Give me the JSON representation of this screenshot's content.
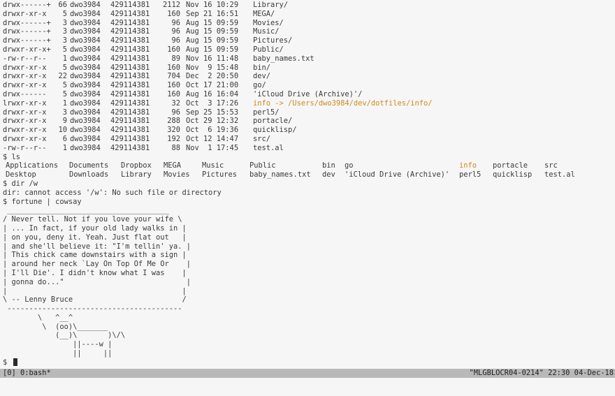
{
  "ls_long": [
    {
      "perm": "drwx------+",
      "links": "66",
      "owner": "dwo3984",
      "group": "429114381",
      "size": "2112",
      "date": "Nov 16 10:29",
      "name": "Library/",
      "link": false
    },
    {
      "perm": "drwxr-xr-x",
      "links": "5",
      "owner": "dwo3984",
      "group": "429114381",
      "size": "160",
      "date": "Sep 21 16:51",
      "name": "MEGA/",
      "link": false
    },
    {
      "perm": "drwx------+",
      "links": "3",
      "owner": "dwo3984",
      "group": "429114381",
      "size": "96",
      "date": "Aug 15 09:59",
      "name": "Movies/",
      "link": false
    },
    {
      "perm": "drwx------+",
      "links": "3",
      "owner": "dwo3984",
      "group": "429114381",
      "size": "96",
      "date": "Aug 15 09:59",
      "name": "Music/",
      "link": false
    },
    {
      "perm": "drwx------+",
      "links": "3",
      "owner": "dwo3984",
      "group": "429114381",
      "size": "96",
      "date": "Aug 15 09:59",
      "name": "Pictures/",
      "link": false
    },
    {
      "perm": "drwxr-xr-x+",
      "links": "5",
      "owner": "dwo3984",
      "group": "429114381",
      "size": "160",
      "date": "Aug 15 09:59",
      "name": "Public/",
      "link": false
    },
    {
      "perm": "-rw-r--r--",
      "links": "1",
      "owner": "dwo3984",
      "group": "429114381",
      "size": "89",
      "date": "Nov 16 11:48",
      "name": "baby_names.txt",
      "link": false
    },
    {
      "perm": "drwxr-xr-x",
      "links": "5",
      "owner": "dwo3984",
      "group": "429114381",
      "size": "160",
      "date": "Nov  9 15:48",
      "name": "bin/",
      "link": false
    },
    {
      "perm": "drwxr-xr-x",
      "links": "22",
      "owner": "dwo3984",
      "group": "429114381",
      "size": "704",
      "date": "Dec  2 20:50",
      "name": "dev/",
      "link": false
    },
    {
      "perm": "drwxr-xr-x",
      "links": "5",
      "owner": "dwo3984",
      "group": "429114381",
      "size": "160",
      "date": "Oct 17 21:00",
      "name": "go/",
      "link": false
    },
    {
      "perm": "drwx------",
      "links": "5",
      "owner": "dwo3984",
      "group": "429114381",
      "size": "160",
      "date": "Aug 16 16:04",
      "name": "'iCloud Drive (Archive)'/",
      "link": false
    },
    {
      "perm": "lrwxr-xr-x",
      "links": "1",
      "owner": "dwo3984",
      "group": "429114381",
      "size": "32",
      "date": "Oct  3 17:26",
      "name": "info",
      "link": true,
      "target": " -> /Users/dwo3984/dev/dotfiles/info/"
    },
    {
      "perm": "drwxr-xr-x",
      "links": "3",
      "owner": "dwo3984",
      "group": "429114381",
      "size": "96",
      "date": "Sep 25 15:53",
      "name": "perl5/",
      "link": false
    },
    {
      "perm": "drwxr-xr-x",
      "links": "9",
      "owner": "dwo3984",
      "group": "429114381",
      "size": "288",
      "date": "Oct 29 12:32",
      "name": "portacle/",
      "link": false
    },
    {
      "perm": "drwxr-xr-x",
      "links": "10",
      "owner": "dwo3984",
      "group": "429114381",
      "size": "320",
      "date": "Oct  6 19:36",
      "name": "quicklisp/",
      "link": false
    },
    {
      "perm": "drwxr-xr-x",
      "links": "6",
      "owner": "dwo3984",
      "group": "429114381",
      "size": "192",
      "date": "Oct 12 14:47",
      "name": "src/",
      "link": false
    },
    {
      "perm": "-rw-r--r--",
      "links": "1",
      "owner": "dwo3984",
      "group": "429114381",
      "size": "88",
      "date": "Nov  1 17:45",
      "name": "test.al",
      "link": false
    }
  ],
  "cmd_ls": "$ ls",
  "ls_grid": [
    [
      {
        "t": "Applications"
      },
      {
        "t": "Documents"
      },
      {
        "t": "Dropbox"
      },
      {
        "t": "MEGA"
      },
      {
        "t": "Music"
      },
      {
        "t": "Public"
      },
      {
        "t": "bin"
      },
      {
        "t": "go"
      },
      {
        "t": "info",
        "link": true
      },
      {
        "t": "portacle"
      },
      {
        "t": "src"
      }
    ],
    [
      {
        "t": "Desktop"
      },
      {
        "t": "Downloads"
      },
      {
        "t": "Library"
      },
      {
        "t": "Movies"
      },
      {
        "t": "Pictures"
      },
      {
        "t": "baby_names.txt"
      },
      {
        "t": "dev"
      },
      {
        "t": "'iCloud Drive (Archive)'"
      },
      {
        "t": "perl5"
      },
      {
        "t": "quicklisp"
      },
      {
        "t": "test.al"
      }
    ]
  ],
  "cmd_dir": "$ dir /w",
  "dir_error": "dir: cannot access '/w': No such file or directory",
  "cmd_fortune": "$ fortune | cowsay",
  "cowsay": " _____________________________________\n/ Never tell. Not if you love your wife \\\n| ... In fact, if your old lady walks in |\n| on you, deny it. Yeah. Just flat out   |\n| and she'll believe it: \"I'm tellin' ya. |\n| This chick came downstairs with a sign |\n| around her neck `Lay On Top Of Me Or    |\n| I'll Die'. I didn't know what I was    |\n| gonna do...\"                            |\n|                                        |\n\\ -- Lenny Bruce                         /\n ----------------------------------------\n        \\   ^__^\n         \\  (oo)\\_______\n            (__)\\       )\\/\\\n                ||----w |\n                ||     ||",
  "prompt": "$ ",
  "statusbar": {
    "left": "[0] 0:bash*",
    "right": "\"MLGBLOCR04-0214\" 22:30 04-Dec-18"
  },
  "colors": {
    "background": "#f6f6f6",
    "text": "#3a3a3a",
    "symlink": "#d08a1a",
    "statusbar": "#b9b9b9"
  }
}
